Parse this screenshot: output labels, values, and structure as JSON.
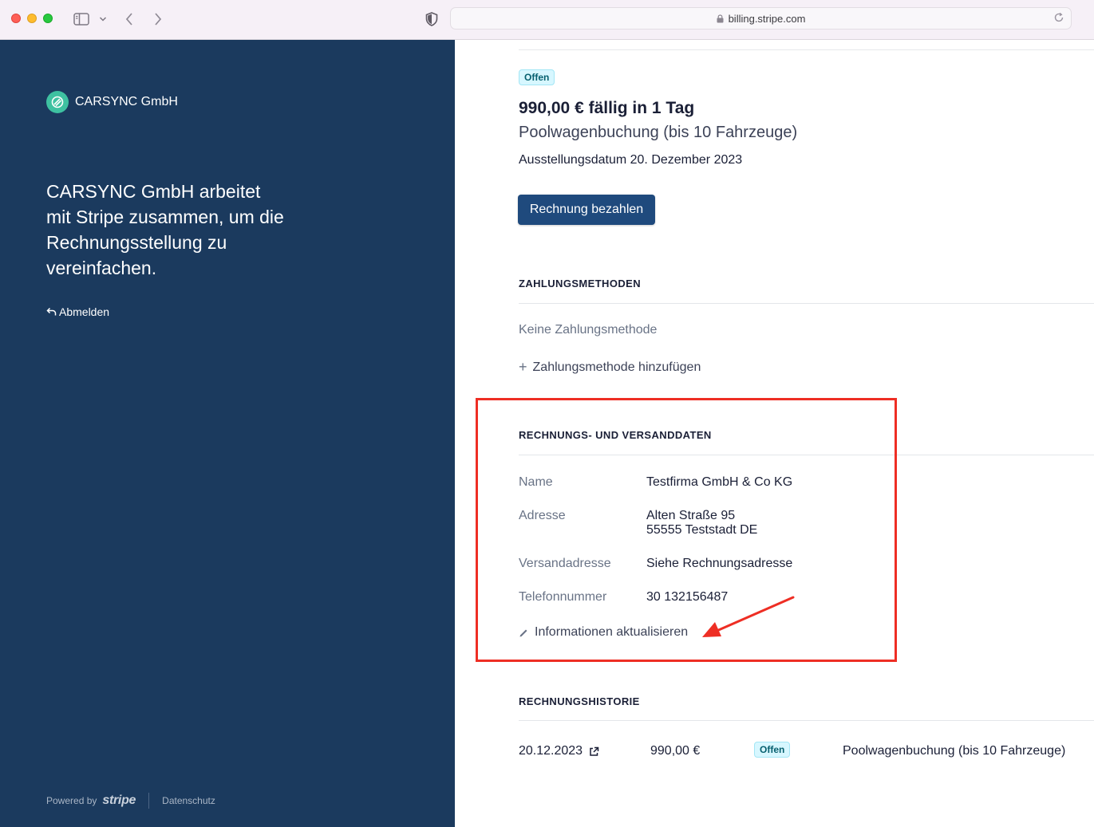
{
  "browser": {
    "url": "billing.stripe.com",
    "icons": [
      "sidebar-icon",
      "chevron-down-icon",
      "back-icon",
      "forward-icon",
      "shield-icon",
      "lock-icon",
      "reload-icon"
    ]
  },
  "sidebar": {
    "company_name": "CARSYNC GmbH",
    "tagline": "CARSYNC GmbH arbeitet mit Stripe zusammen, um die Rechnungsstellung zu vereinfachen.",
    "logout_label": "Abmelden",
    "footer": {
      "powered_by": "Powered by",
      "stripe": "stripe",
      "privacy": "Datenschutz"
    },
    "colors": {
      "background": "#1b3a5e",
      "logo": "#3ec1a1"
    }
  },
  "invoice": {
    "status": "Offen",
    "amount_due": "990,00 € fällig in 1 Tag",
    "plan": "Poolwagenbuchung (bis 10 Fahrzeuge)",
    "issued": "Ausstellungsdatum 20. Dezember 2023",
    "pay_button": "Rechnung bezahlen"
  },
  "payment_methods": {
    "title": "ZAHLUNGSMETHODEN",
    "empty_text": "Keine Zahlungsmethode",
    "add_label": "Zahlungsmethode hinzufügen"
  },
  "billing_info": {
    "title": "RECHNUNGS- UND VERSANDDATEN",
    "name_label": "Name",
    "name_value": "Testfirma GmbH & Co KG",
    "address_label": "Adresse",
    "address_line1": "Alten Straße 95",
    "address_line2": "55555 Teststadt DE",
    "shipping_label": "Versandadresse",
    "shipping_value": "Siehe Rechnungsadresse",
    "phone_label": "Telefonnummer",
    "phone_value": "30 132156487",
    "update_label": "Informationen aktualisieren"
  },
  "history": {
    "title": "RECHNUNGSHISTORIE",
    "rows": [
      {
        "date": "20.12.2023",
        "amount": "990,00 €",
        "status": "Offen",
        "description": "Poolwagenbuchung (bis 10 Fahrzeuge)"
      }
    ]
  },
  "annotation": {
    "color": "#ee2e24"
  }
}
